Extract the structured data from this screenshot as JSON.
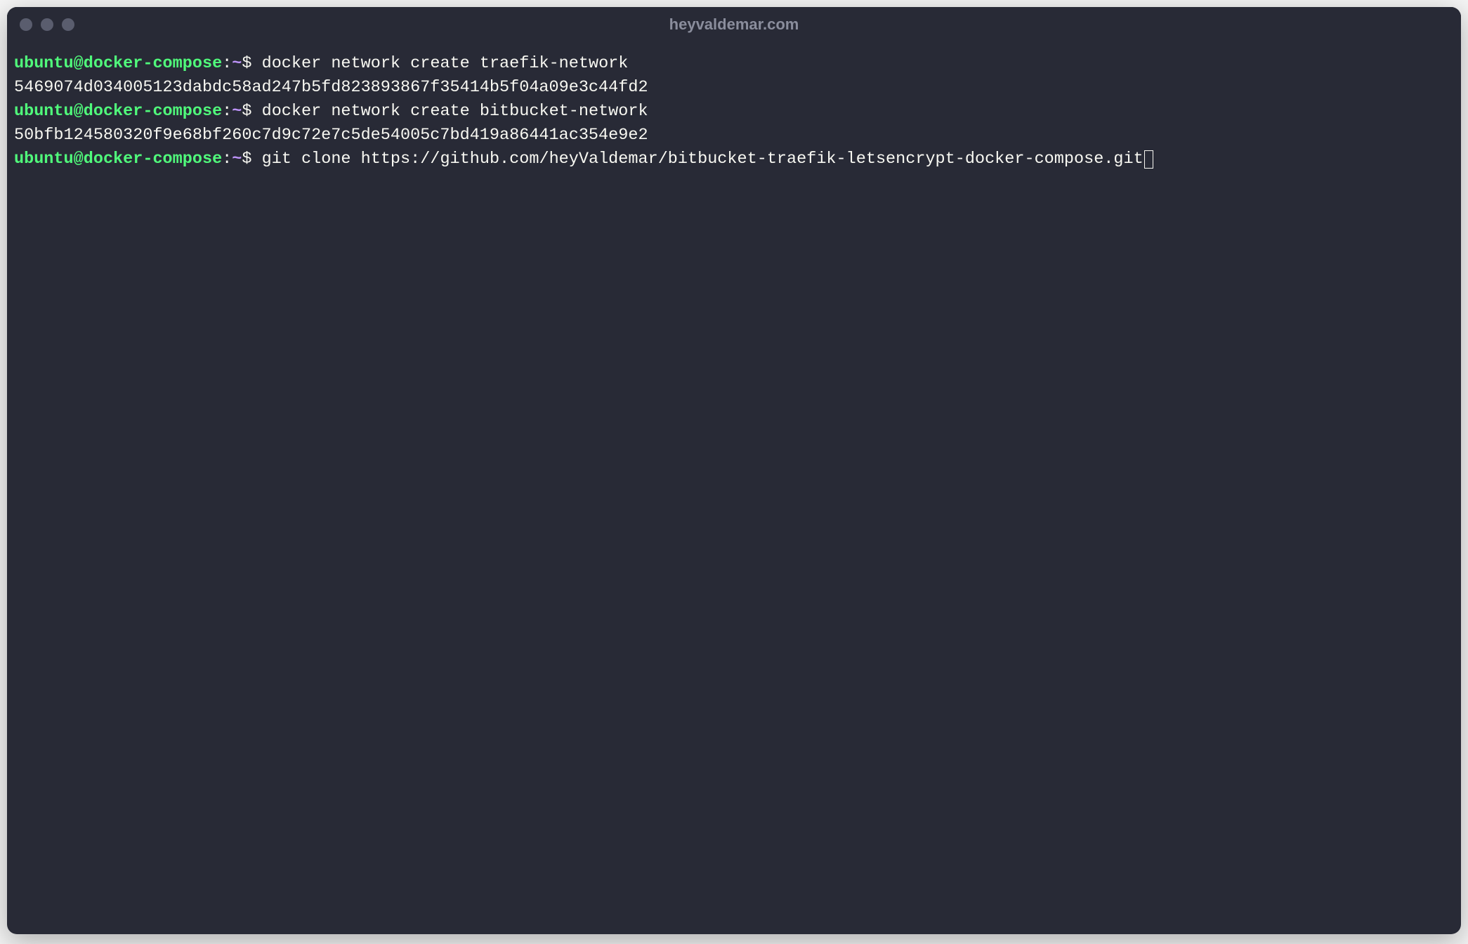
{
  "window": {
    "title": "heyvaldemar.com"
  },
  "prompt": {
    "user": "ubuntu",
    "at": "@",
    "host": "docker-compose",
    "colon": ":",
    "path": "~",
    "dollar": "$"
  },
  "lines": {
    "cmd1": " docker network create traefik-network",
    "out1": "5469074d034005123dabdc58ad247b5fd823893867f35414b5f04a09e3c44fd2",
    "cmd2": " docker network create bitbucket-network",
    "out2": "50bfb124580320f9e68bf260c7d9c72e7c5de54005c7bd419a86441ac354e9e2",
    "cmd3": " git clone https://github.com/heyValdemar/bitbucket-traefik-letsencrypt-docker-compose.git"
  }
}
